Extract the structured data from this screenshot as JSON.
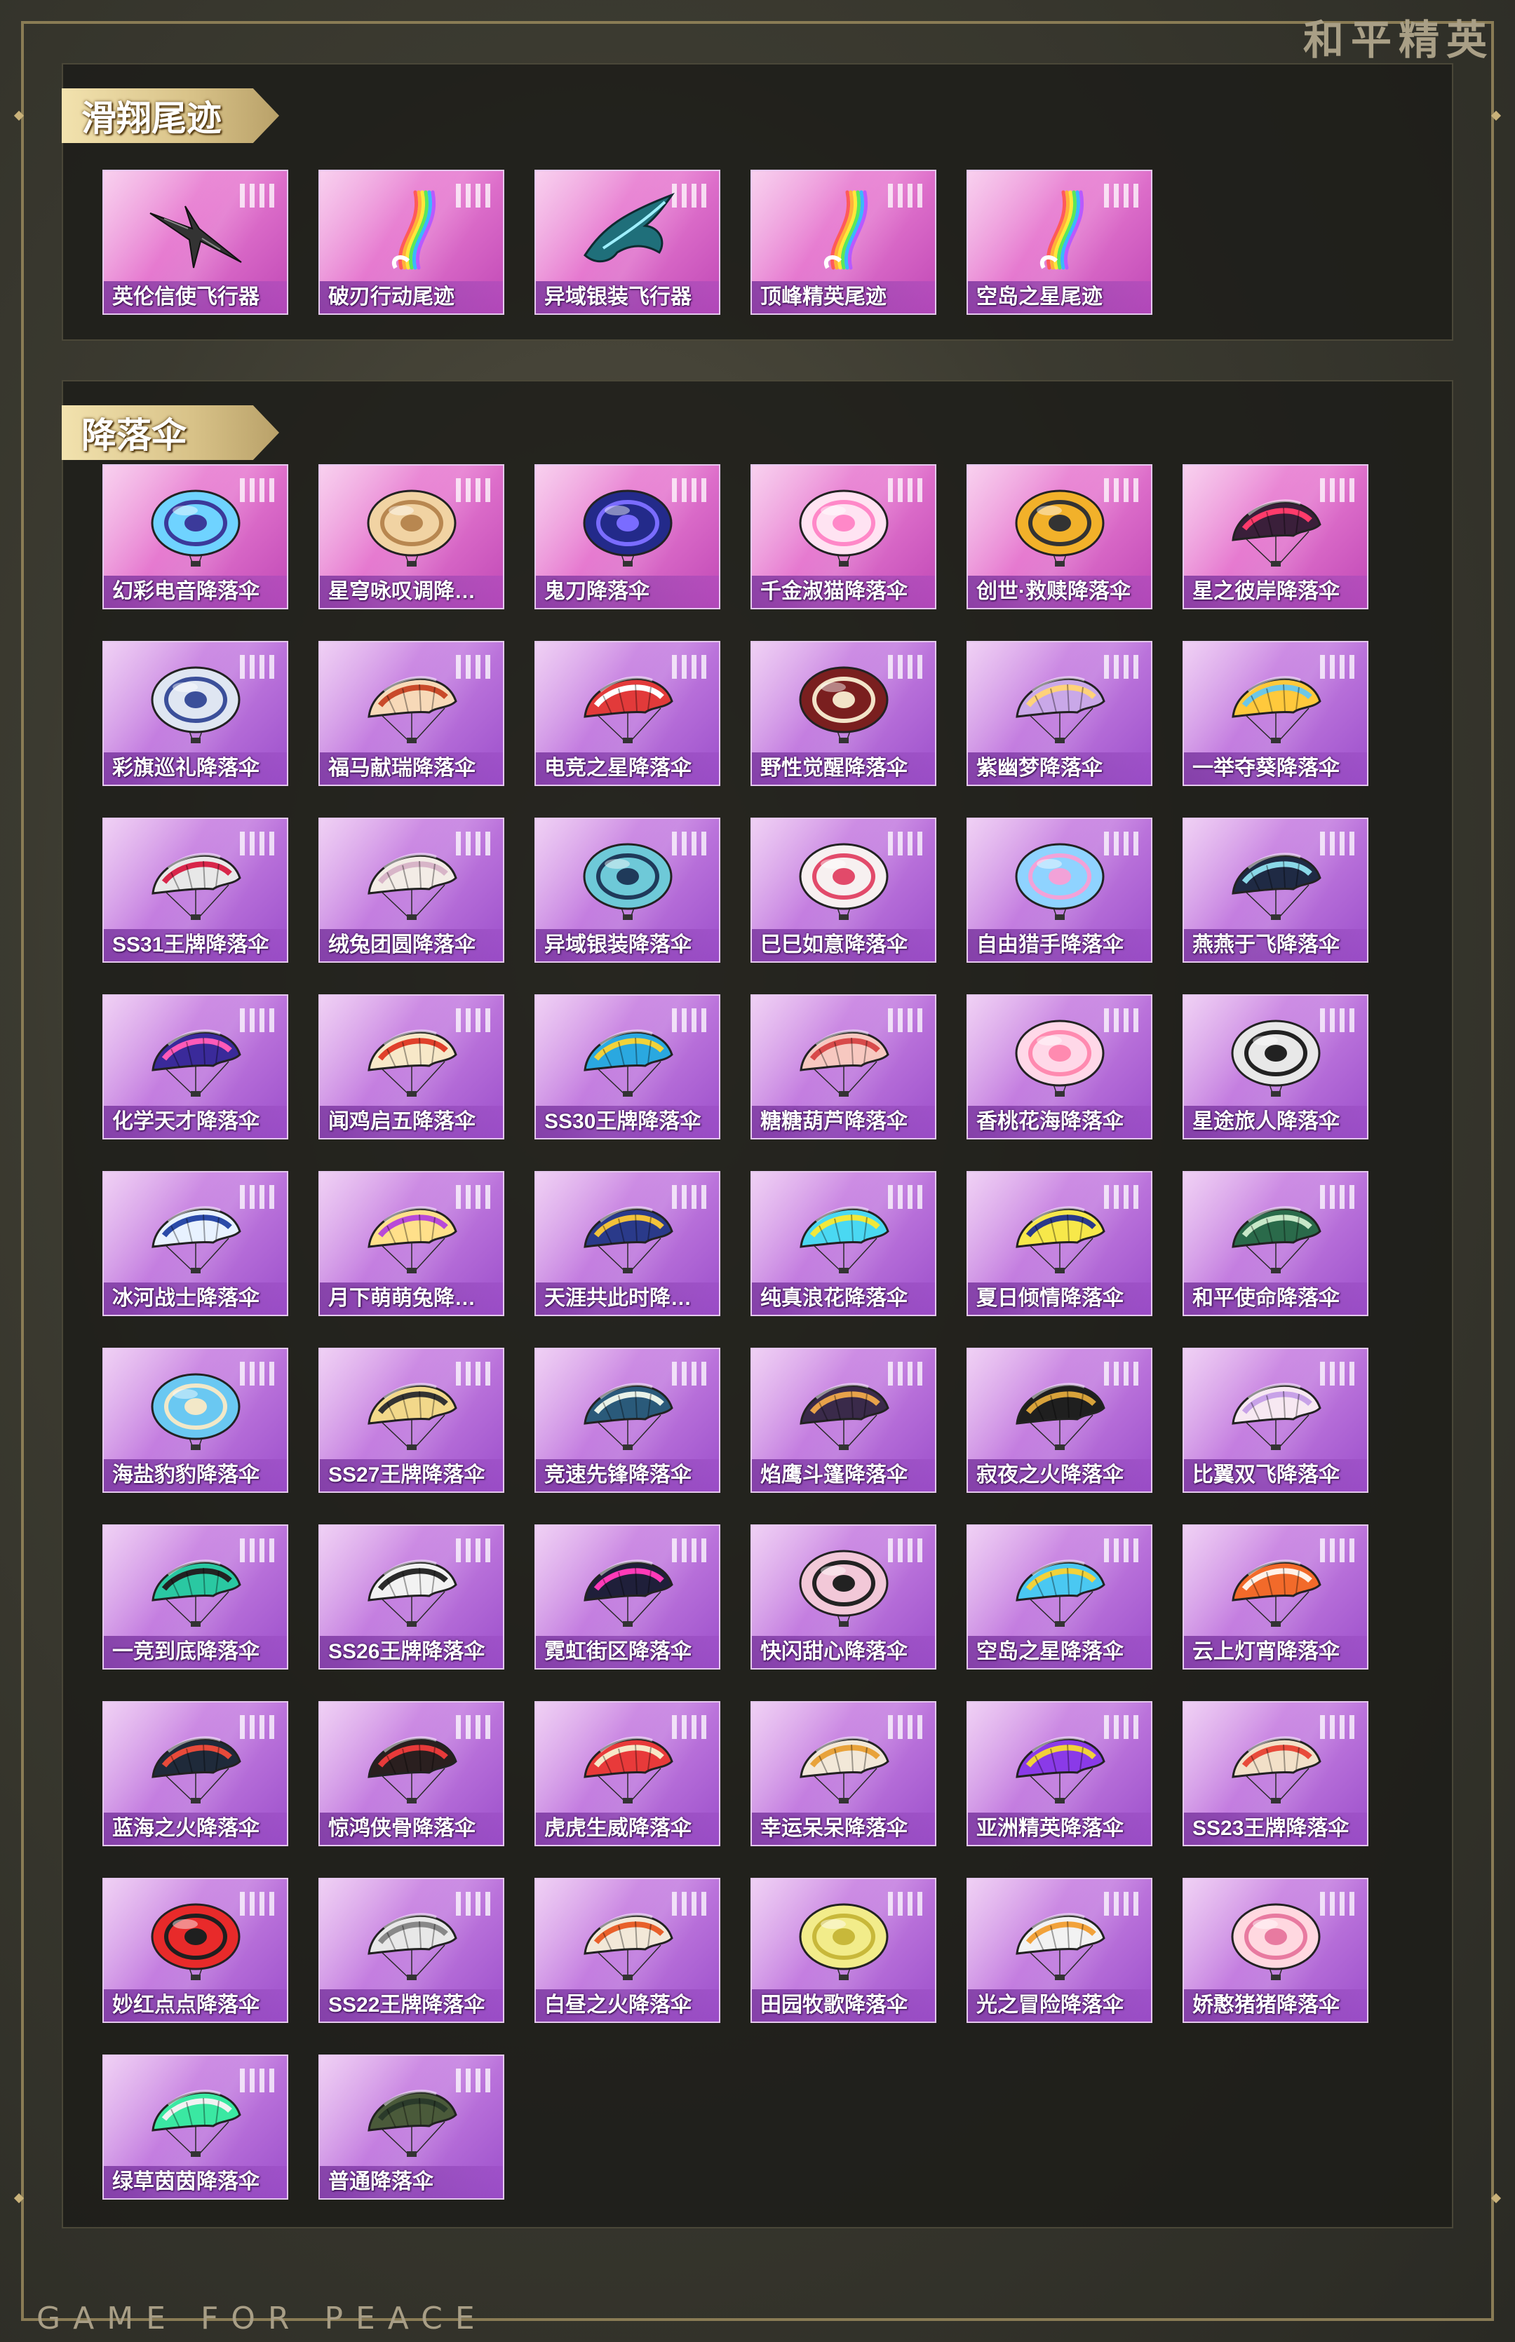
{
  "brand": {
    "title": "和平精英",
    "footer": "GAME FOR PEACE"
  },
  "sections": {
    "trail": {
      "title": "滑翔尾迹"
    },
    "parachute": {
      "title": "降落伞"
    }
  },
  "trail_items": [
    {
      "label": "英伦信使飞行器",
      "icon": "bird-glider-icon",
      "color": "#333333"
    },
    {
      "label": "破刃行动尾迹",
      "icon": "rainbow-trail-icon",
      "color": "#ff6ad5"
    },
    {
      "label": "异域银装飞行器",
      "icon": "winged-glider-icon",
      "color": "#1f6f7a"
    },
    {
      "label": "顶峰精英尾迹",
      "icon": "rainbow-trail-icon",
      "color": "#ff8a3c"
    },
    {
      "label": "空岛之星尾迹",
      "icon": "rainbow-trail-icon",
      "color": "#5ad0ff"
    }
  ],
  "parachute_items": [
    {
      "label": "幻彩电音降落伞",
      "shape": "round",
      "color": "#6fd3ff",
      "accent": "#3b3a9a"
    },
    {
      "label": "星穹咏叹调降…",
      "shape": "round",
      "color": "#f1d3a3",
      "accent": "#b88750"
    },
    {
      "label": "鬼刀降落伞",
      "shape": "round",
      "color": "#232a8a",
      "accent": "#7a6cff"
    },
    {
      "label": "千金淑猫降落伞",
      "shape": "round",
      "color": "#ffe3f2",
      "accent": "#ff88c8"
    },
    {
      "label": "创世·救赎降落伞",
      "shape": "round",
      "color": "#f2b12a",
      "accent": "#333333"
    },
    {
      "label": "星之彼岸降落伞",
      "shape": "dome",
      "color": "#3a1f3a",
      "accent": "#ff3b6b"
    },
    {
      "label": "彩旗巡礼降落伞",
      "shape": "round",
      "color": "#dfe6f2",
      "accent": "#3b4f9a"
    },
    {
      "label": "福马献瑞降落伞",
      "shape": "dome",
      "color": "#f7d9b8",
      "accent": "#c94a2a"
    },
    {
      "label": "电竞之星降落伞",
      "shape": "dome",
      "color": "#e23a3a",
      "accent": "#ffffff"
    },
    {
      "label": "野性觉醒降落伞",
      "shape": "round",
      "color": "#7a1f1f",
      "accent": "#f2e3c8"
    },
    {
      "label": "紫幽梦降落伞",
      "shape": "dome",
      "color": "#c9a8e8",
      "accent": "#ffd27a"
    },
    {
      "label": "一举夺葵降落伞",
      "shape": "dome",
      "color": "#ffc93c",
      "accent": "#6bc7e8"
    },
    {
      "label": "SS31王牌降落伞",
      "shape": "dome",
      "color": "#e8e8e8",
      "accent": "#d8264a"
    },
    {
      "label": "绒兔团圆降落伞",
      "shape": "dome",
      "color": "#f3ece6",
      "accent": "#d8b5c8"
    },
    {
      "label": "异域银装降落伞",
      "shape": "round",
      "color": "#6ec9d8",
      "accent": "#1f3a5a"
    },
    {
      "label": "巳巳如意降落伞",
      "shape": "round",
      "color": "#f7f0f0",
      "accent": "#e24a6a"
    },
    {
      "label": "自由猎手降落伞",
      "shape": "round",
      "color": "#8fd3ff",
      "accent": "#f2a2d8"
    },
    {
      "label": "燕燕于飞降落伞",
      "shape": "dome",
      "color": "#1f2a44",
      "accent": "#8ad8e8"
    },
    {
      "label": "化学天才降落伞",
      "shape": "dome",
      "color": "#3a2a9a",
      "accent": "#ff5ab8"
    },
    {
      "label": "闻鸡启五降落伞",
      "shape": "dome",
      "color": "#f7e8c8",
      "accent": "#e0402a"
    },
    {
      "label": "SS30王牌降落伞",
      "shape": "dome",
      "color": "#2aa8e0",
      "accent": "#f2d23a"
    },
    {
      "label": "糖糖葫芦降落伞",
      "shape": "dome",
      "color": "#f7c8c0",
      "accent": "#d84a4a"
    },
    {
      "label": "香桃花海降落伞",
      "shape": "round",
      "color": "#ffd8e8",
      "accent": "#ff8ab0"
    },
    {
      "label": "星途旅人降落伞",
      "shape": "round",
      "color": "#e8e8e8",
      "accent": "#222222"
    },
    {
      "label": "冰河战士降落伞",
      "shape": "dome",
      "color": "#e8f2ff",
      "accent": "#2a4aa8"
    },
    {
      "label": "月下萌萌兔降…",
      "shape": "dome",
      "color": "#ffe08a",
      "accent": "#b84ad8"
    },
    {
      "label": "天涯共此时降…",
      "shape": "dome",
      "color": "#2a3a8a",
      "accent": "#f2c23a"
    },
    {
      "label": "纯真浪花降落伞",
      "shape": "dome",
      "color": "#4ad8f2",
      "accent": "#f2e83a"
    },
    {
      "label": "夏日倾情降落伞",
      "shape": "dome",
      "color": "#f7e84a",
      "accent": "#2a3a8a"
    },
    {
      "label": "和平使命降落伞",
      "shape": "dome",
      "color": "#2a6a4a",
      "accent": "#c8e8c8"
    },
    {
      "label": "海盐豹豹降落伞",
      "shape": "round",
      "color": "#6ac8f2",
      "accent": "#f2e8c8"
    },
    {
      "label": "SS27王牌降落伞",
      "shape": "dome",
      "color": "#f2d88a",
      "accent": "#333333"
    },
    {
      "label": "竞速先锋降落伞",
      "shape": "dome",
      "color": "#2a5a7a",
      "accent": "#e8f2e8"
    },
    {
      "label": "焰鹰斗篷降落伞",
      "shape": "dome",
      "color": "#3a2a4a",
      "accent": "#e8a24a"
    },
    {
      "label": "寂夜之火降落伞",
      "shape": "dome",
      "color": "#1f1f1f",
      "accent": "#d8a23a"
    },
    {
      "label": "比翼双飞降落伞",
      "shape": "dome",
      "color": "#f7e8f2",
      "accent": "#c8a2e8"
    },
    {
      "label": "一竞到底降落伞",
      "shape": "dome",
      "color": "#2ac8a2",
      "accent": "#222222"
    },
    {
      "label": "SS26王牌降落伞",
      "shape": "dome",
      "color": "#f2f2f2",
      "accent": "#2a2a2a"
    },
    {
      "label": "霓虹街区降落伞",
      "shape": "dome",
      "color": "#1f1f3a",
      "accent": "#ff3ab8"
    },
    {
      "label": "快闪甜心降落伞",
      "shape": "round",
      "color": "#f2c8d8",
      "accent": "#222222"
    },
    {
      "label": "空岛之星降落伞",
      "shape": "dome",
      "color": "#4ac8f2",
      "accent": "#f2d23a"
    },
    {
      "label": "云上灯宵降落伞",
      "shape": "dome",
      "color": "#f26a2a",
      "accent": "#fff2e8"
    },
    {
      "label": "蓝海之火降落伞",
      "shape": "dome",
      "color": "#1f2a3a",
      "accent": "#e84a3a"
    },
    {
      "label": "惊鸿侠骨降落伞",
      "shape": "dome",
      "color": "#2a1f1f",
      "accent": "#e83a3a"
    },
    {
      "label": "虎虎生威降落伞",
      "shape": "dome",
      "color": "#e83a3a",
      "accent": "#f7e8c8"
    },
    {
      "label": "幸运呆呆降落伞",
      "shape": "dome",
      "color": "#f2e8d8",
      "accent": "#e8a23a"
    },
    {
      "label": "亚洲精英降落伞",
      "shape": "dome",
      "color": "#8a3ae8",
      "accent": "#f2d23a"
    },
    {
      "label": "SS23王牌降落伞",
      "shape": "dome",
      "color": "#f2e0c8",
      "accent": "#e84a3a"
    },
    {
      "label": "妙红点点降落伞",
      "shape": "round",
      "color": "#e82a2a",
      "accent": "#1f1f1f"
    },
    {
      "label": "SS22王牌降落伞",
      "shape": "dome",
      "color": "#e8e8e8",
      "accent": "#888888"
    },
    {
      "label": "白昼之火降落伞",
      "shape": "dome",
      "color": "#f2e8d8",
      "accent": "#e8602a"
    },
    {
      "label": "田园牧歌降落伞",
      "shape": "round",
      "color": "#f2ec8a",
      "accent": "#c8b83a"
    },
    {
      "label": "光之冒险降落伞",
      "shape": "dome",
      "color": "#f2f2f2",
      "accent": "#f2a23a"
    },
    {
      "label": "娇憨猪猪降落伞",
      "shape": "round",
      "color": "#ffd8e0",
      "accent": "#e87aa0"
    },
    {
      "label": "绿草茵茵降落伞",
      "shape": "dome",
      "color": "#3ae8a2",
      "accent": "#f2f2f2"
    },
    {
      "label": "普通降落伞",
      "shape": "dome",
      "color": "#4a5a3a",
      "accent": "#2a3a2a"
    }
  ]
}
